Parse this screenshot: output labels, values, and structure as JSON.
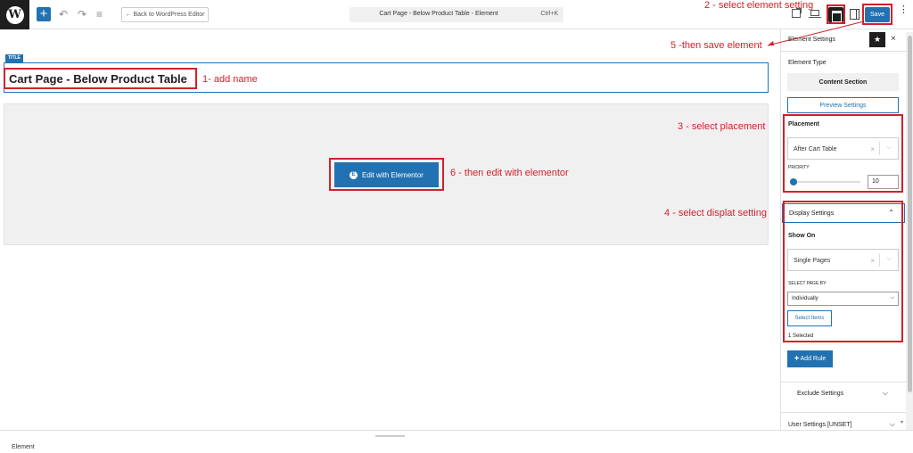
{
  "topbar": {
    "wp_logo": "W",
    "back_label": "← Back to WordPress Editor",
    "command_title": "Cart Page - Below Product Table - Element",
    "shortcut": "Ctrl+K",
    "save_label": "Save",
    "icons": {
      "add": "+",
      "undo": "↶",
      "redo": "↷",
      "list": "≡",
      "kebab": "⋮"
    }
  },
  "annotations": {
    "a1": "1- add name",
    "a2": "2 - select element setting",
    "a3": "3 - select placement",
    "a4": "4 - select displat setting",
    "a5": "5 -then save element",
    "a6": "6 - then edit with elementor"
  },
  "canvas": {
    "title_tag": "TITLE",
    "title_text": "Cart Page - Below Product Table",
    "edit_button": "Edit with Elementor",
    "edit_icon": "E"
  },
  "sidebar": {
    "header_title": "Element Settings",
    "star": "★",
    "close": "×",
    "element_type_label": "Element Type",
    "element_type_value": "Content Section",
    "preview_label": "Preview Settings",
    "placement_label": "Placement",
    "placement_value": "After Cart Table",
    "priority_label": "PRIORITY",
    "priority_value": "10",
    "display_settings_label": "Display Settings",
    "show_on_label": "Show On",
    "show_on_value": "Single Pages",
    "select_page_by_label": "SELECT PAGE BY:",
    "select_page_by_value": "Individually",
    "select_items_label": "Select Items",
    "selected_count": "1 Selected",
    "add_rule_label": "Add Rule",
    "add_rule_icon": "+",
    "exclude_label": "Exclude Settings",
    "user_settings_label": "User Settings [UNSET]",
    "clear_glyph": "×",
    "chevron_down": "⌵",
    "chevron_up": "⌃",
    "scroll_down": "▾"
  },
  "footer": {
    "breadcrumb": "Element"
  },
  "colors": {
    "accent": "#2271b1",
    "annotation": "#d4202a"
  }
}
